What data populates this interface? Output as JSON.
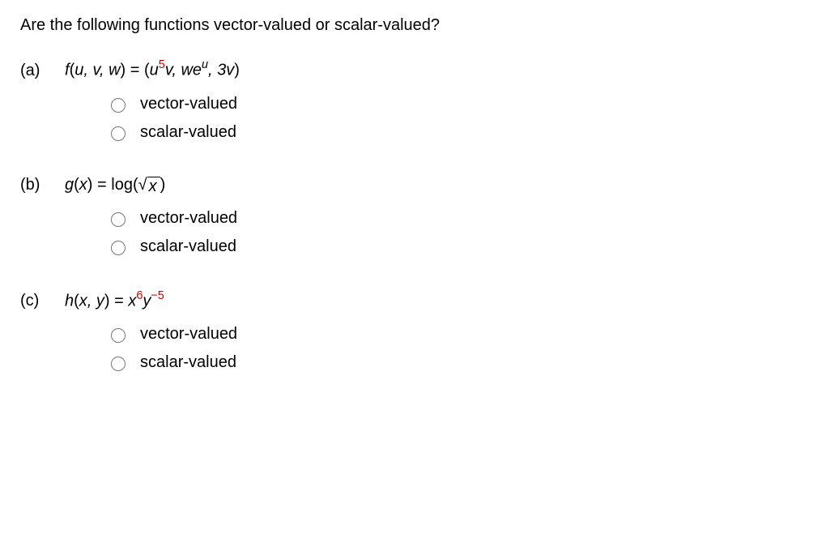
{
  "question": "Are the following functions vector-valued or scalar-valued?",
  "parts": {
    "a": {
      "label": "(a)",
      "fn": "f",
      "args": "u, v, w",
      "eq1_base1": "u",
      "eq1_exp1": "5",
      "eq1_after1": "v, we",
      "eq1_exp2": "u",
      "eq1_after2": ", 3v",
      "opt_vector": "vector-valued",
      "opt_scalar": "scalar-valued"
    },
    "b": {
      "label": "(b)",
      "fn": "g",
      "args": "x",
      "log": "log(",
      "radicand": "x",
      "close": ")",
      "opt_vector": "vector-valued",
      "opt_scalar": "scalar-valued"
    },
    "c": {
      "label": "(c)",
      "fn": "h",
      "args": "x, y",
      "base1": "x",
      "exp1": "6",
      "base2": "y",
      "exp2": "−5",
      "opt_vector": "vector-valued",
      "opt_scalar": "scalar-valued"
    }
  }
}
